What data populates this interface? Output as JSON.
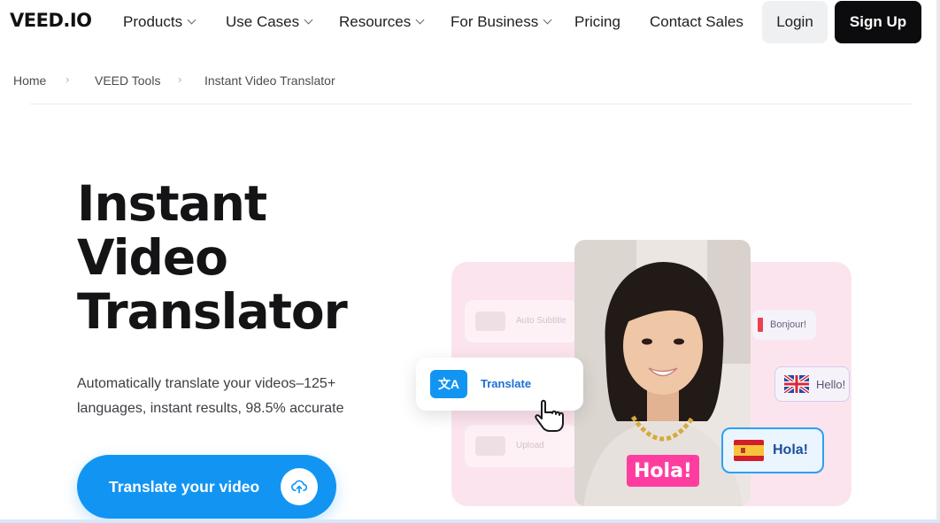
{
  "nav": {
    "logo": "VEED.IO",
    "items": [
      {
        "label": "Products",
        "dropdown": true
      },
      {
        "label": "Use Cases",
        "dropdown": true
      },
      {
        "label": "Resources",
        "dropdown": true
      },
      {
        "label": "For Business",
        "dropdown": true
      },
      {
        "label": "Pricing",
        "dropdown": false
      },
      {
        "label": "Contact Sales",
        "dropdown": false
      }
    ],
    "login": "Login",
    "signup": "Sign Up"
  },
  "breadcrumb": [
    "Home",
    "VEED Tools",
    "Instant Video Translator"
  ],
  "hero": {
    "title_lines": [
      "Instant",
      "Video",
      "Translator"
    ],
    "subtitle": "Automatically translate your videos–125+ languages, instant results, 98.5% accurate",
    "cta": "Translate your video"
  },
  "illustration": {
    "ghost_auto_subtitle": "Auto Subtitle",
    "ghost_upload": "Upload",
    "translate_label": "Translate",
    "bubble_french": "Bonjour!",
    "bubble_english": "Hello!",
    "bubble_spanish": "Hola!",
    "caption": "Hola!"
  },
  "colors": {
    "accent": "#1295f2",
    "caption_pink": "#ff3da0",
    "signup_bg": "#0c0c0e"
  }
}
